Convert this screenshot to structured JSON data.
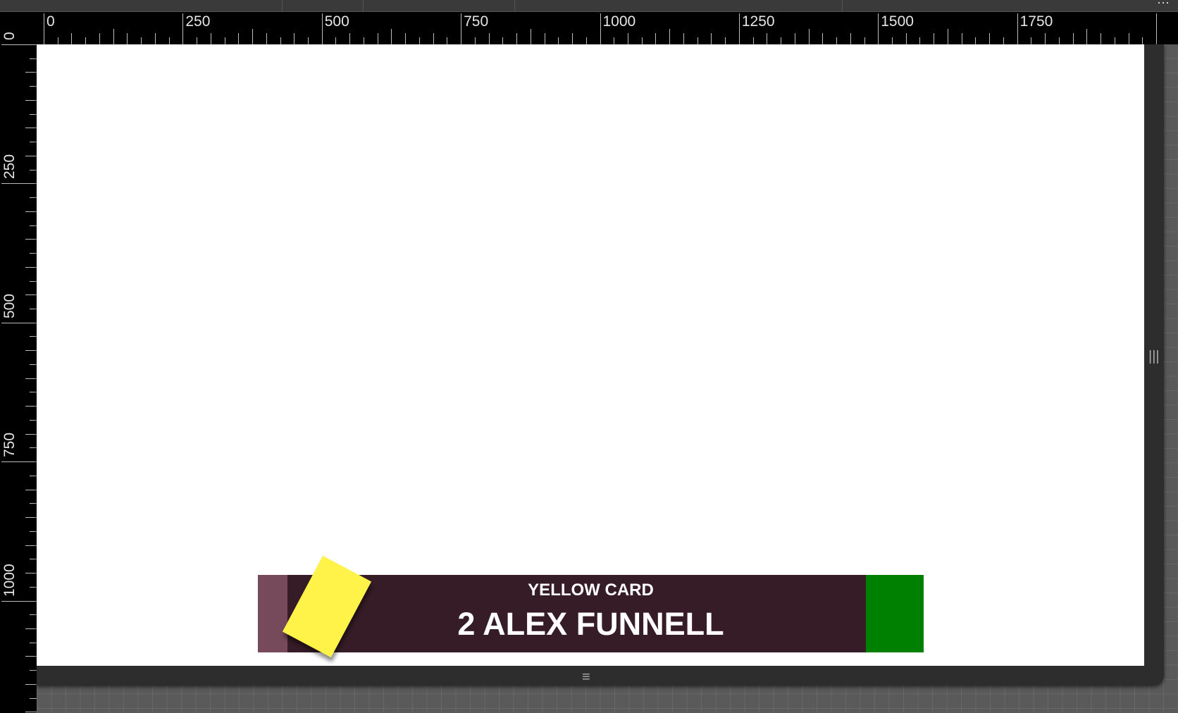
{
  "ruler": {
    "horizontal_labels": [
      "0",
      "250",
      "500",
      "750",
      "1000",
      "1250",
      "1500",
      "1750"
    ],
    "vertical_labels": [
      "0",
      "250",
      "500",
      "750",
      "1000"
    ]
  },
  "lower_third": {
    "title": "YELLOW CARD",
    "player": "2 ALEX FUNNELL",
    "colors": {
      "background": "#361c26",
      "left_accent": "#774a5b",
      "right_accent": "#008000",
      "card": "#fff34a"
    }
  },
  "icons": {
    "side_handle": "vertical-resize-handle-icon",
    "bottom_handle": "horizontal-resize-handle-icon",
    "overflow_menu": "more-icon",
    "yellow_card": "yellow-card-icon"
  }
}
